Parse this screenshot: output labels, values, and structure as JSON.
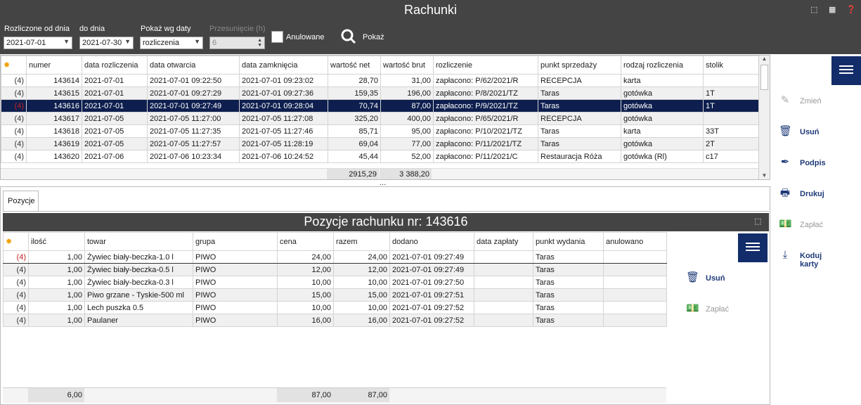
{
  "window": {
    "title": "Rachunki"
  },
  "filters": {
    "from_label": "Rozliczone od dnia",
    "from_value": "2021-07-01",
    "to_label": "do dnia",
    "to_value": "2021-07-30",
    "show_label": "Pokaż wg daty",
    "show_value": "rozliczenia",
    "shift_label": "Przesunięcie (h)",
    "shift_value": "6",
    "cancelled_label": "Anulowane",
    "show_button": "Pokaż"
  },
  "bills": {
    "columns": [
      "numer",
      "data rozliczenia",
      "data otwarcia",
      "data zamknięcia",
      "wartość net",
      "wartość brut",
      "rozliczenie",
      "punkt sprzedaży",
      "rodzaj rozliczenia",
      "stolik"
    ],
    "rows": [
      [
        "(4)",
        "143614",
        "2021-07-01",
        "2021-07-01 09:22:50",
        "2021-07-01 09:23:02",
        "28,70",
        "31,00",
        "zapłacono: P/62/2021/R",
        "RECEPCJA",
        "karta",
        ""
      ],
      [
        "(4)",
        "143615",
        "2021-07-01",
        "2021-07-01 09:27:29",
        "2021-07-01 09:27:36",
        "159,35",
        "196,00",
        "zapłacono: P/8/2021/TZ",
        "Taras",
        "gotówka",
        "1T"
      ],
      [
        "(4)",
        "143616",
        "2021-07-01",
        "2021-07-01 09:27:49",
        "2021-07-01 09:28:04",
        "70,74",
        "87,00",
        "zapłacono: P/9/2021/TZ",
        "Taras",
        "gotówka",
        "1T"
      ],
      [
        "(4)",
        "143617",
        "2021-07-05",
        "2021-07-05 11:27:00",
        "2021-07-05 11:27:08",
        "325,20",
        "400,00",
        "zapłacono: P/65/2021/R",
        "RECEPCJA",
        "gotówka",
        ""
      ],
      [
        "(4)",
        "143618",
        "2021-07-05",
        "2021-07-05 11:27:35",
        "2021-07-05 11:27:46",
        "85,71",
        "95,00",
        "zapłacono: P/10/2021/TZ",
        "Taras",
        "karta",
        "33T"
      ],
      [
        "(4)",
        "143619",
        "2021-07-05",
        "2021-07-05 11:27:57",
        "2021-07-05 11:28:19",
        "69,04",
        "77,00",
        "zapłacono: P/11/2021/TZ",
        "Taras",
        "gotówka",
        "2T"
      ],
      [
        "(4)",
        "143620",
        "2021-07-06",
        "2021-07-06 10:23:34",
        "2021-07-06 10:24:52",
        "45,44",
        "52,00",
        "zapłacono: P/11/2021/C",
        "Restauracja Róża",
        "gotówka (Rl)",
        "c17"
      ]
    ],
    "sum_net": "2915,29",
    "sum_gross": "3 388,20",
    "splitter": "..."
  },
  "tabs": {
    "positions": "Pozycje"
  },
  "positions": {
    "title": "Pozycje rachunku nr: 143616",
    "columns": [
      "ilość",
      "towar",
      "grupa",
      "cena",
      "razem",
      "dodano",
      "data zapłaty",
      "punkt wydania",
      "anulowano"
    ],
    "rows": [
      [
        "(4)",
        "1,00",
        "Żywiec biały-beczka-1.0 l",
        "PIWO",
        "24,00",
        "24,00",
        "2021-07-01 09:27:49",
        "",
        "Taras",
        ""
      ],
      [
        "(4)",
        "1,00",
        "Żywiec biały-beczka-0.5 l",
        "PIWO",
        "12,00",
        "12,00",
        "2021-07-01 09:27:49",
        "",
        "Taras",
        ""
      ],
      [
        "(4)",
        "1,00",
        "Żywiec biały-beczka-0.3 l",
        "PIWO",
        "10,00",
        "10,00",
        "2021-07-01 09:27:50",
        "",
        "Taras",
        ""
      ],
      [
        "(4)",
        "1,00",
        "Piwo grzane - Tyskie-500 ml",
        "PIWO",
        "15,00",
        "15,00",
        "2021-07-01 09:27:51",
        "",
        "Taras",
        ""
      ],
      [
        "(4)",
        "1,00",
        "Lech puszka 0.5",
        "PIWO",
        "10,00",
        "10,00",
        "2021-07-01 09:27:52",
        "",
        "Taras",
        ""
      ],
      [
        "(4)",
        "1,00",
        "Paulaner",
        "PIWO",
        "16,00",
        "16,00",
        "2021-07-01 09:27:52",
        "",
        "Taras",
        ""
      ]
    ],
    "sum_qty": "6,00",
    "sum_price": "87,00",
    "sum_total": "87,00"
  },
  "actions": {
    "edit": "Zmień",
    "delete": "Usuń",
    "sign": "Podpis",
    "print": "Drukuj",
    "pay": "Zapłać",
    "encode": "Koduj karty"
  },
  "pos_actions": {
    "delete": "Usuń",
    "pay": "Zapłać"
  }
}
